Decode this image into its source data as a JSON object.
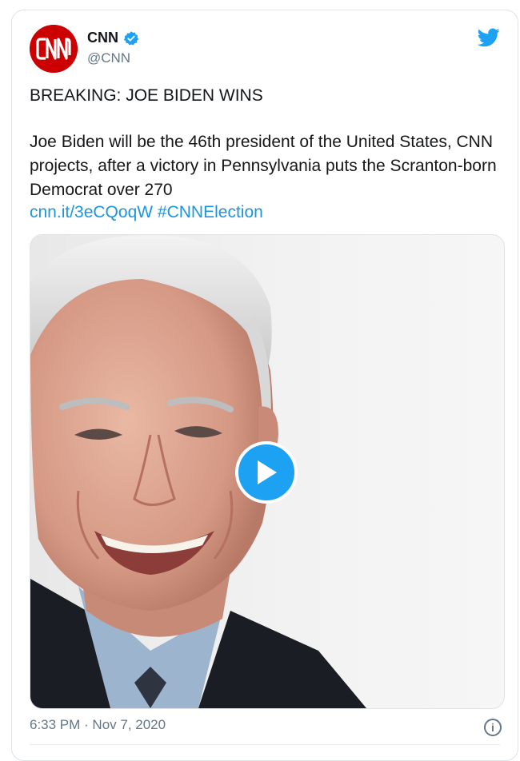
{
  "account": {
    "name": "CNN",
    "handle": "@CNN",
    "logo_text": "CNN"
  },
  "tweet": {
    "headline": "BREAKING: JOE BIDEN WINS",
    "body": "Joe Biden will be the 46th president of the United States, CNN projects, after a victory in Pennsylvania puts the Scranton-born Democrat over 270",
    "link": "cnn.it/3eCQoqW",
    "hashtag": "#CNNElection"
  },
  "media": {
    "type": "video",
    "play_icon": "play-icon"
  },
  "footer": {
    "timestamp": "6:33 PM · Nov 7, 2020",
    "info_icon": "info-icon"
  },
  "colors": {
    "link_blue": "#1b95e0",
    "twitter_blue": "#1da1f2",
    "cnn_red": "#cc0000",
    "secondary_text": "#657786"
  }
}
